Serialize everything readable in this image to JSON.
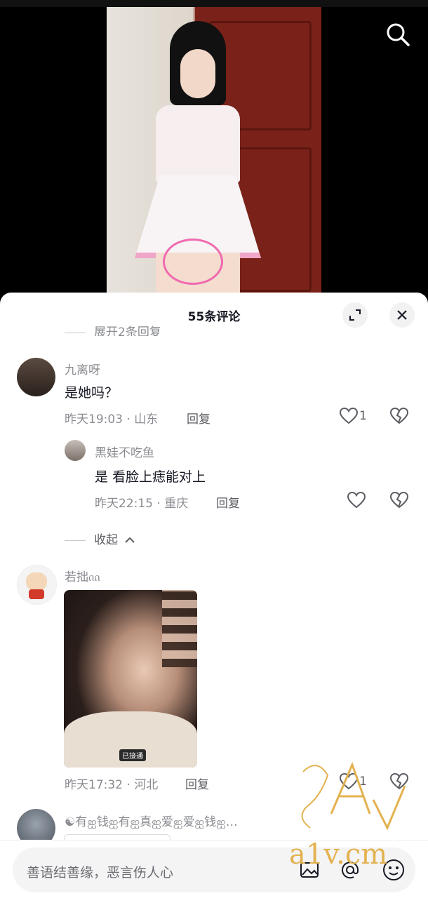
{
  "header": {
    "comment_count_title": "55条评论"
  },
  "comments": [
    {
      "expand_label": "展开2条回复",
      "user": "九离呀",
      "text": "是她吗？",
      "time": "昨天19:03",
      "location": "山东",
      "reply_label": "回复",
      "like_count": "1",
      "replies": [
        {
          "user": "黑娃不吃鱼",
          "text": "是 看脸上痣能对上",
          "time": "昨天22:15",
          "location": "重庆",
          "reply_label": "回复"
        }
      ],
      "collapse_label": "收起"
    },
    {
      "user": "若拙ᦶ",
      "image_badge": "已接通",
      "time": "昨天17:32",
      "location": "河北",
      "reply_label": "回复",
      "like_count": "1"
    },
    {
      "user": "☯有ஐ钱ஐ有ஐ真ஐ爱ஐ爱ஐ钱ஐ…"
    }
  ],
  "input": {
    "placeholder": "善语结善缘，恶言伤人心"
  },
  "watermark": {
    "text": "a1v.cm",
    "logo_letters": "A1V"
  },
  "colors": {
    "accent_pink": "#f06ab0",
    "text_primary": "#161823",
    "text_secondary": "#8a8b91"
  }
}
